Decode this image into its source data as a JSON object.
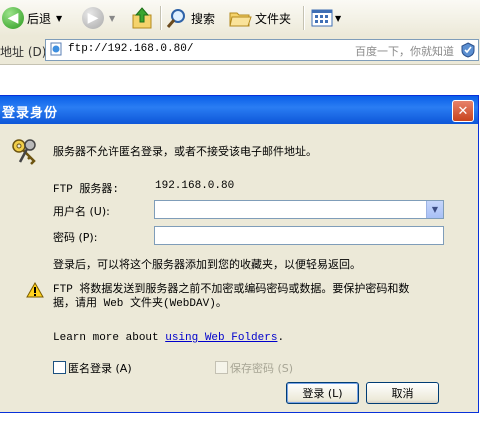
{
  "toolbar": {
    "back_label": "后退",
    "search_label": "搜索",
    "folders_label": "文件夹"
  },
  "address_bar": {
    "label": "地址 (D)",
    "url": "ftp://192.168.0.80/",
    "search_hint": "百度一下，你就知道"
  },
  "dialog": {
    "title": "登录身份",
    "close_glyph": "✕",
    "message": "服务器不允许匿名登录，或者不接受该电子邮件地址。",
    "server_label": "FTP 服务器:",
    "server_value": "192.168.0.80",
    "username_label": "用户名 (U):",
    "username_value": "",
    "password_label": "密码 (P):",
    "password_value": "",
    "after_login_note": "登录后，可以将这个服务器添加到您的收藏夹，以便轻易返回。",
    "warning_line1": "FTP 将数据发送到服务器之前不加密或编码密码或数据。要保护密码和数",
    "warning_line2": "据，请用 Web 文件夹(WebDAV)。",
    "learn_more_prefix": "Learn more about ",
    "learn_more_link": "using Web Folders",
    "learn_more_suffix": ".",
    "anonymous_label": "匿名登录 (A)",
    "save_password_label": "保存密码 (S)",
    "login_button": "登录 (L)",
    "cancel_button": "取消"
  },
  "colors": {
    "titlebar_blue": "#0a5fe8",
    "dialog_bg": "#ece9d8",
    "link_blue": "#0000cc"
  },
  "icons": [
    "back-arrow-icon",
    "forward-arrow-icon",
    "up-folder-icon",
    "search-icon",
    "folders-icon",
    "views-icon",
    "page-icon",
    "go-icon",
    "keys-icon",
    "warning-icon",
    "close-icon",
    "dropdown-arrow-icon"
  ]
}
